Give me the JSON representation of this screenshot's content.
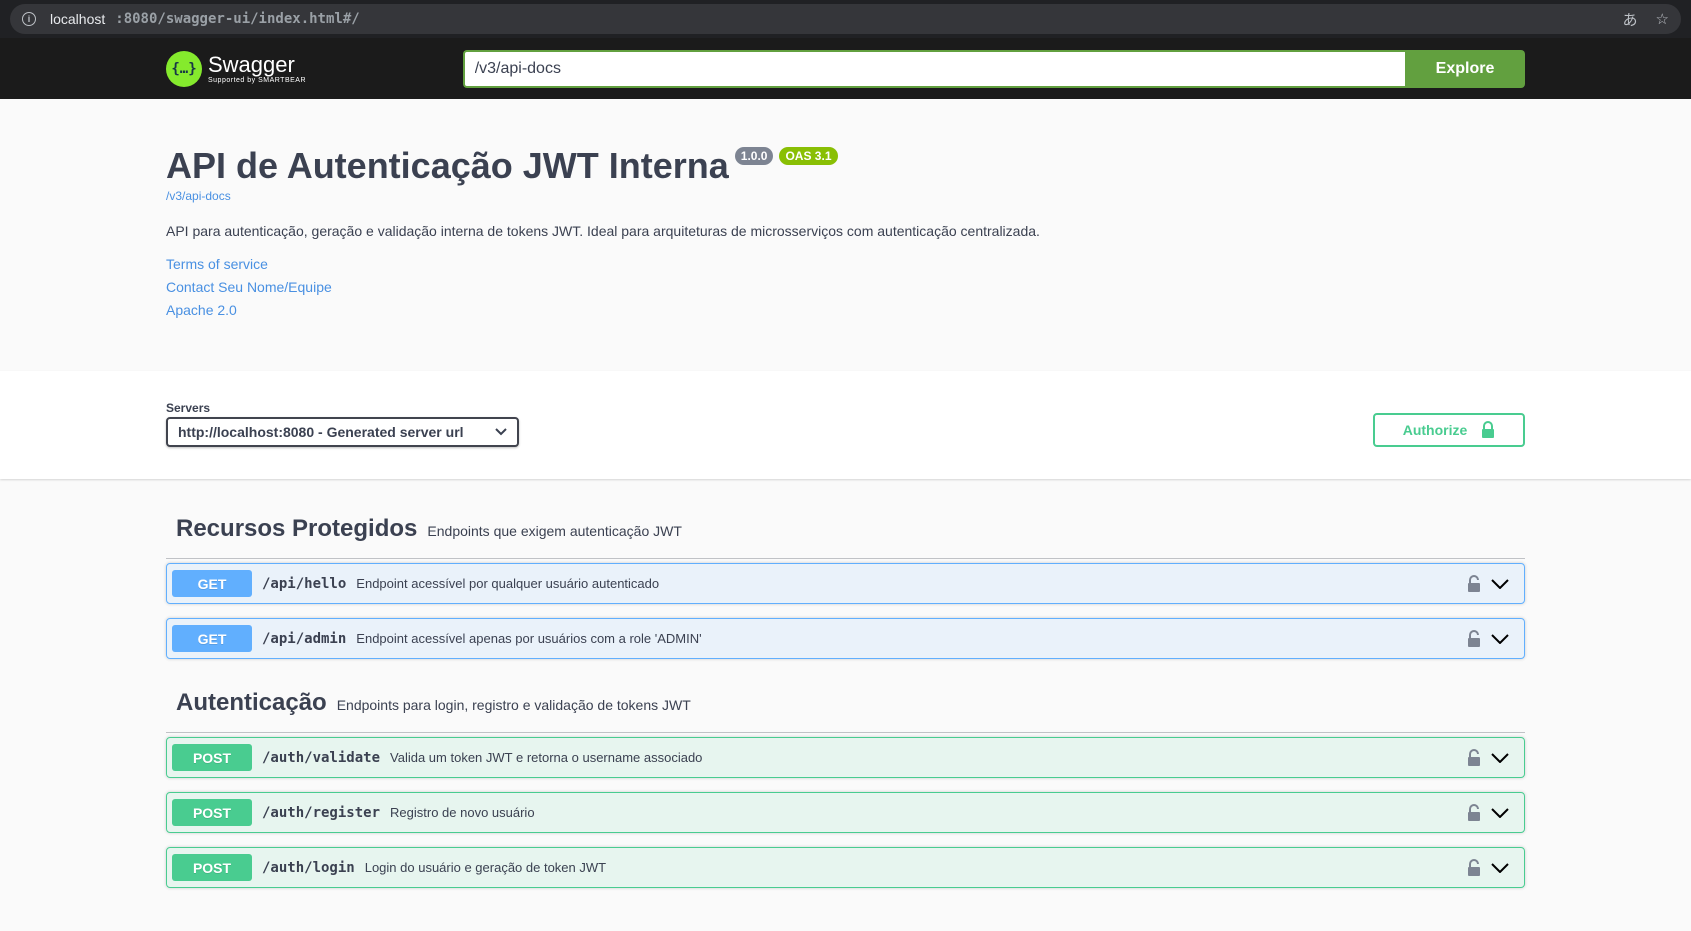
{
  "browser": {
    "url_host": "localhost",
    "url_rest": ":8080/swagger-ui/index.html#/"
  },
  "topbar": {
    "logo_name": "Swagger",
    "logo_sub": "Supported by SMARTBEAR",
    "spec_url": "/v3/api-docs",
    "explore_label": "Explore"
  },
  "info": {
    "title": "API de Autenticação JWT Interna",
    "version": "1.0.0",
    "oas": "OAS 3.1",
    "spec_link": "/v3/api-docs",
    "description": "API para autenticação, geração e validação interna de tokens JWT. Ideal para arquiteturas de microsserviços com autenticação centralizada.",
    "links": [
      "Terms of service",
      "Contact Seu Nome/Equipe",
      "Apache 2.0"
    ]
  },
  "servers": {
    "title": "Servers",
    "selected": "http://localhost:8080 - Generated server url",
    "authorize_label": "Authorize"
  },
  "tags": [
    {
      "name": "Recursos Protegidos",
      "description": "Endpoints que exigem autenticação JWT",
      "operations": [
        {
          "method": "GET",
          "path": "/api/hello",
          "summary": "Endpoint acessível por qualquer usuário autenticado"
        },
        {
          "method": "GET",
          "path": "/api/admin",
          "summary": "Endpoint acessível apenas por usuários com a role 'ADMIN'"
        }
      ]
    },
    {
      "name": "Autenticação",
      "description": "Endpoints para login, registro e validação de tokens JWT",
      "operations": [
        {
          "method": "POST",
          "path": "/auth/validate",
          "summary": "Valida um token JWT e retorna o username associado"
        },
        {
          "method": "POST",
          "path": "/auth/register",
          "summary": "Registro de novo usuário"
        },
        {
          "method": "POST",
          "path": "/auth/login",
          "summary": "Login do usuário e geração de token JWT"
        }
      ]
    }
  ],
  "colors": {
    "get": "#61affe",
    "post": "#49cc90",
    "explore": "#62a03f",
    "link": "#4990e2"
  },
  "icons": {
    "lock": "lock-icon",
    "chevron": "chevron-down-icon"
  }
}
